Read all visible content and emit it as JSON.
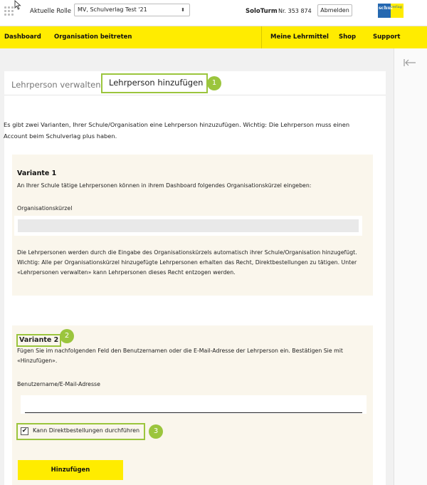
{
  "topbar": {
    "role_label": "Aktuelle Rolle",
    "role_value": "MV, Schulverlag Test '21",
    "brand": "SoloTurm",
    "number": "Nr. 353 874",
    "logout": "Abmelden",
    "logo_left": "schul",
    "logo_right": "verlag"
  },
  "nav": {
    "dashboard": "Dashboard",
    "join_org": "Organisation beitreten",
    "my_materials": "Meine Lehrmittel",
    "shop": "Shop",
    "support": "Support"
  },
  "tabs": {
    "manage": "Lehrperson verwalten",
    "add": "Lehrperson hinzufügen",
    "badge1": "1"
  },
  "intro": "Es gibt zwei Varianten, Ihrer Schule/Organisation eine Lehrperson hinzuzufügen. Wichtig: Die Lehrperson muss einen Account beim Schulverlag plus haben.",
  "variant1": {
    "title": "Variante 1",
    "desc": "An Ihrer Schule tätige Lehrpersonen können in ihrem Dashboard folgendes Organisationskürzel eingeben:",
    "field_label": "Organisationskürzel",
    "note": "Die Lehrpersonen werden durch die Eingabe des Organisationskürzels automatisch ihrer Schule/Organisation hinzugefügt. Wichtig: Alle per Organisationskürzel hinzugefügte Lehrpersonen erhalten das Recht, Direktbestellungen zu tätigen. Unter «Lehrpersonen verwalten» kann Lehrpersonen dieses Recht entzogen werden."
  },
  "variant2": {
    "title": "Variante 2",
    "badge2": "2",
    "desc": "Fügen Sie im nachfolgenden Feld den Benutzernamen oder die E-Mail-Adresse der Lehrperson ein. Bestätigen Sie mit «Hinzufügen».",
    "field_label": "Benutzername/E-Mail-Adresse",
    "field_value": "",
    "checkbox_label": "Kann Direktbestellungen durchführen",
    "checkbox_checked": true,
    "badge3": "3",
    "submit": "Hinzufügen"
  },
  "colors": {
    "brand_yellow": "#ffec00",
    "highlight_green": "#9bc53d",
    "panel_beige": "#faf6ec"
  }
}
